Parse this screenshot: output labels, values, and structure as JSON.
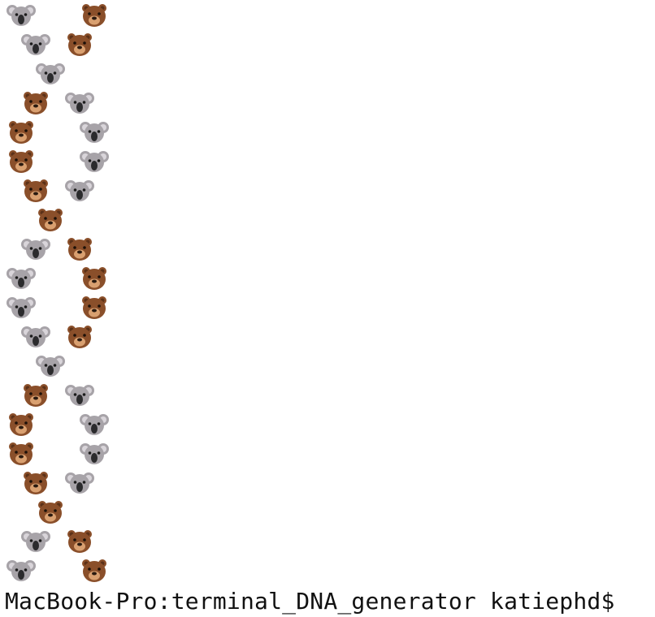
{
  "terminal": {
    "prompt": "MacBook-Pro:terminal_DNA_generator katiephd$"
  },
  "colors": {
    "background": "#ffffff",
    "text": "#111111",
    "koala_fur": "#a7a3a8",
    "koala_ear_inner": "#d9d5da",
    "koala_nose": "#2b2b2d",
    "bear_fur": "#8a4f2a",
    "bear_muzzle": "#d9a070",
    "bear_nose": "#2a1a10"
  },
  "icons": {
    "koala": "koala-face-icon",
    "bear": "bear-face-icon"
  },
  "helix": {
    "strand_pattern": [
      [
        "koala",
        "bear"
      ],
      [
        "koala",
        "bear"
      ],
      [
        "koala"
      ],
      [
        "bear",
        "koala"
      ],
      [
        "bear",
        "koala"
      ],
      [
        "bear",
        "koala"
      ],
      [
        "bear",
        "koala"
      ],
      [
        "bear"
      ],
      [
        "koala",
        "bear"
      ],
      [
        "koala",
        "bear"
      ],
      [
        "koala",
        "bear"
      ],
      [
        "koala",
        "bear"
      ],
      [
        "koala"
      ],
      [
        "bear",
        "koala"
      ],
      [
        "bear",
        "koala"
      ],
      [
        "bear",
        "koala"
      ],
      [
        "bear",
        "koala"
      ],
      [
        "bear"
      ],
      [
        "koala",
        "bear"
      ],
      [
        "koala",
        "bear"
      ]
    ]
  }
}
